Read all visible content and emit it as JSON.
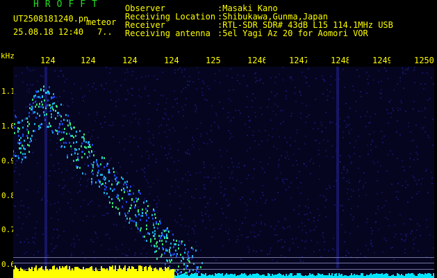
{
  "header": {
    "app_title": "HROFFT",
    "file_name": "UT2508181240.pn",
    "meteor_label": "meteor",
    "date_time": "25.08.18 12:40",
    "frame_no": "7.."
  },
  "station_info": [
    {
      "label": "Observer",
      "value": ":Masaki Kano"
    },
    {
      "label": "Receiving Location",
      "value": ":Shibukawa,Gunma,Japan"
    },
    {
      "label": "Receiver",
      "value": ":RTL-SDR SDR# 43dB L15 114.1MHz USB"
    },
    {
      "label": "Receiving antenna",
      "value": ":5el Yagi Az 20 for Aomori VOR"
    }
  ],
  "axes": {
    "y_unit": "kHz",
    "y_ticks": [
      "1.1",
      "1.0",
      "0.9",
      "0.8",
      "0.7",
      "0.6"
    ],
    "x_ticks": [
      "124",
      "124",
      "124",
      "124",
      "125",
      "1246",
      "1247",
      "1248",
      "1249",
      "1250"
    ]
  },
  "colors": {
    "background": "#000000",
    "text": "#ffff00",
    "title": "#22dd22",
    "plot_bg": "#050520",
    "noise": "#16166a",
    "echo_bright": "#20c8ff",
    "echo_green": "#40ff80",
    "yellow_band": "#ffff00",
    "cyan_band": "#00e5ff"
  }
}
